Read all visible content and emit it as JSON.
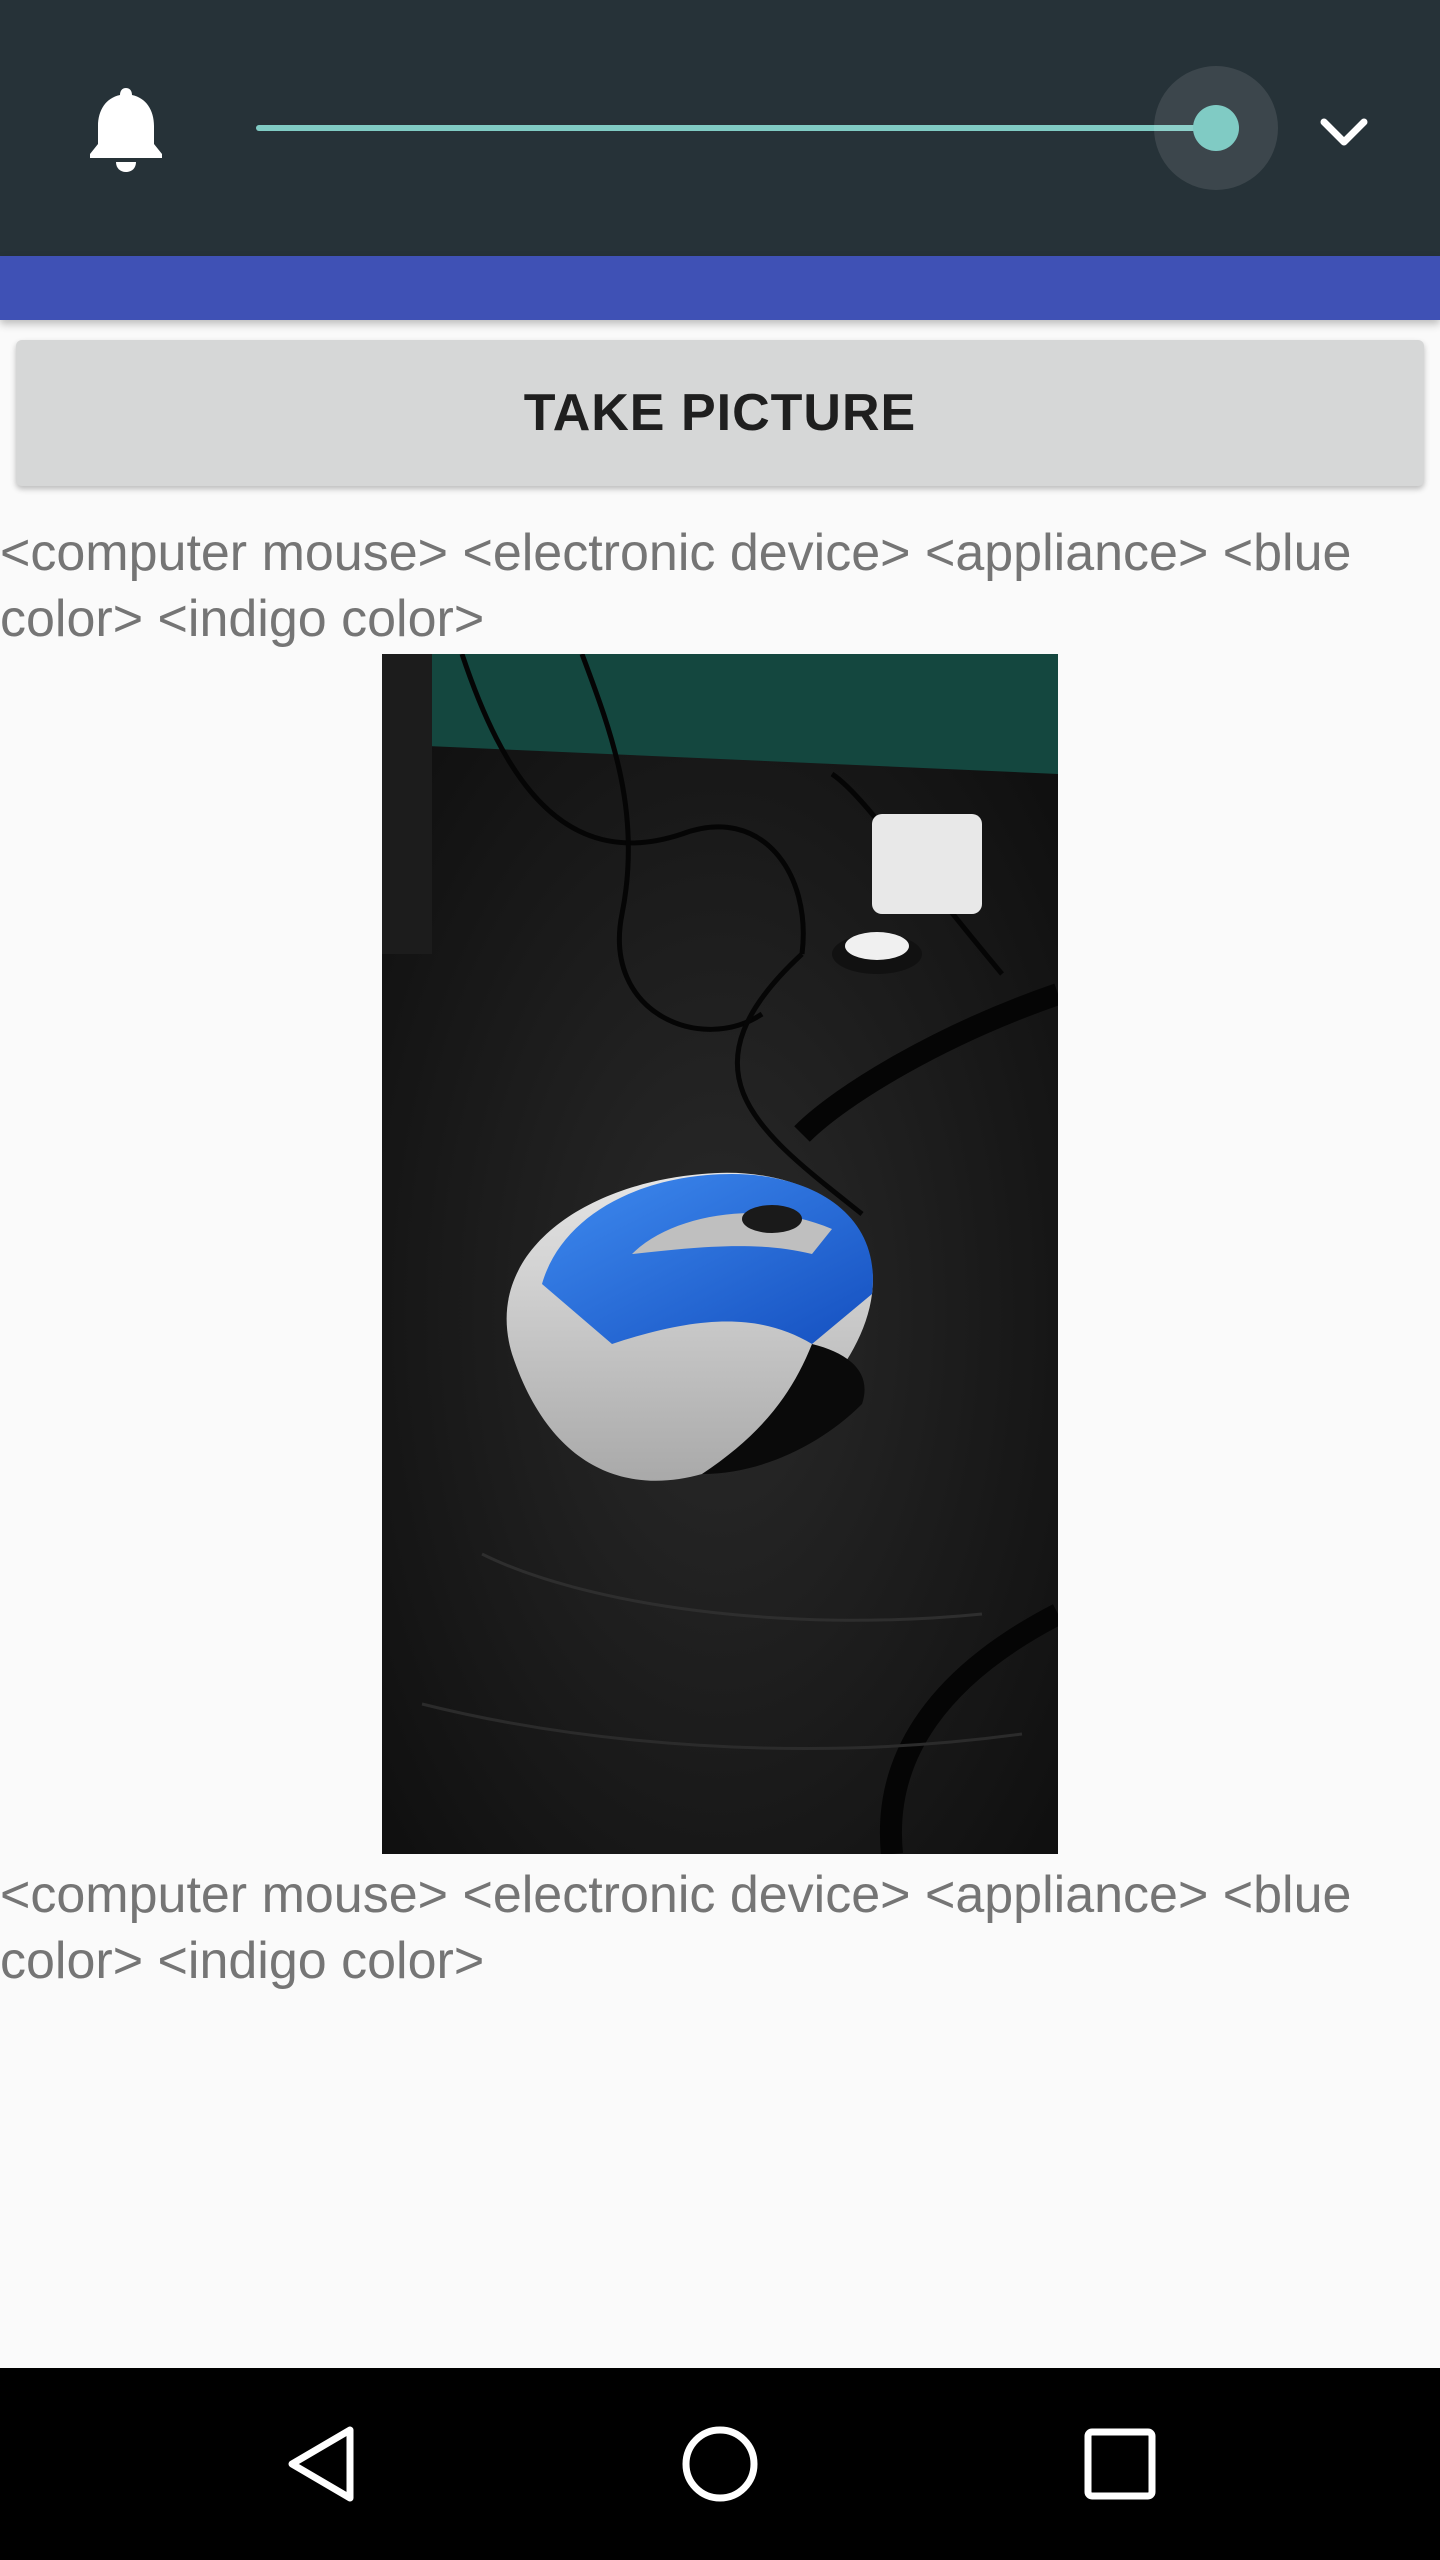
{
  "volume_panel": {
    "icons": {
      "ringer": "bell-icon",
      "expand": "chevron-down-icon"
    },
    "slider": {
      "level_percent": 100
    },
    "colors": {
      "background": "#263238",
      "accent": "#80cbc4"
    }
  },
  "app": {
    "colors": {
      "primary": "#3f51b5",
      "button": "#d6d7d7",
      "background": "#fafafa"
    },
    "take_picture_label": "TAKE PICTURE",
    "labels_top": "<computer mouse> <electronic device> <appliance> <blue color> <indigo color>",
    "labels_bottom": "<computer mouse> <electronic device> <appliance> <blue color> <indigo color>"
  },
  "nav_bar": {
    "icons": {
      "back": "back-triangle-icon",
      "home": "home-circle-icon",
      "recents": "recents-square-icon"
    }
  }
}
